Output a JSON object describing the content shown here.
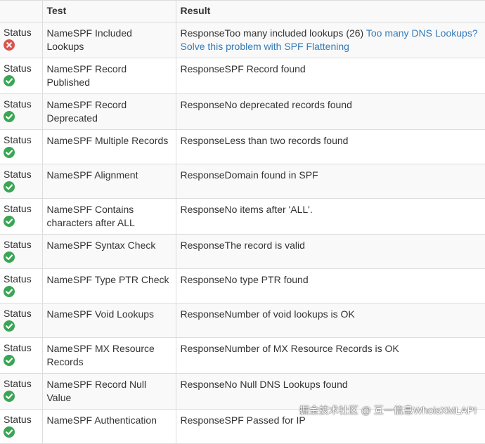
{
  "table": {
    "headers": {
      "status": "",
      "test": "Test",
      "result": "Result"
    },
    "rows": [
      {
        "status_label": "Status",
        "status": "fail",
        "name_prefix": "Name",
        "test": "SPF Included Lookups",
        "response_prefix": "Response",
        "result": "Too many included lookups (26) ",
        "link": "Too many DNS Lookups? Solve this problem with SPF Flattening"
      },
      {
        "status_label": "Status",
        "status": "ok",
        "name_prefix": "Name",
        "test": "SPF Record Published",
        "response_prefix": "Response",
        "result": "SPF Record found",
        "link": ""
      },
      {
        "status_label": "Status",
        "status": "ok",
        "name_prefix": "Name",
        "test": "SPF Record Deprecated",
        "response_prefix": "Response",
        "result": "No deprecated records found",
        "link": ""
      },
      {
        "status_label": "Status",
        "status": "ok",
        "name_prefix": "Name",
        "test": "SPF Multiple Records",
        "response_prefix": "Response",
        "result": "Less than two records found",
        "link": ""
      },
      {
        "status_label": "Status",
        "status": "ok",
        "name_prefix": "Name",
        "test": "SPF Alignment",
        "response_prefix": "Response",
        "result": "Domain found in SPF",
        "link": ""
      },
      {
        "status_label": "Status",
        "status": "ok",
        "name_prefix": "Name",
        "test": "SPF Contains characters after ALL",
        "response_prefix": "Response",
        "result": "No items after 'ALL'.",
        "link": ""
      },
      {
        "status_label": "Status",
        "status": "ok",
        "name_prefix": "Name",
        "test": "SPF Syntax Check",
        "response_prefix": "Response",
        "result": "The record is valid",
        "link": ""
      },
      {
        "status_label": "Status",
        "status": "ok",
        "name_prefix": "Name",
        "test": "SPF Type PTR Check",
        "response_prefix": "Response",
        "result": "No type PTR found",
        "link": ""
      },
      {
        "status_label": "Status",
        "status": "ok",
        "name_prefix": "Name",
        "test": "SPF Void Lookups",
        "response_prefix": "Response",
        "result": "Number of void lookups is OK",
        "link": ""
      },
      {
        "status_label": "Status",
        "status": "ok",
        "name_prefix": "Name",
        "test": "SPF MX Resource Records",
        "response_prefix": "Response",
        "result": "Number of MX Resource Records is OK",
        "link": ""
      },
      {
        "status_label": "Status",
        "status": "ok",
        "name_prefix": "Name",
        "test": "SPF Record Null Value",
        "response_prefix": "Response",
        "result": "No Null DNS Lookups found",
        "link": ""
      },
      {
        "status_label": "Status",
        "status": "ok",
        "name_prefix": "Name",
        "test": "SPF Authentication",
        "response_prefix": "Response",
        "result": "SPF Passed for IP",
        "link": ""
      }
    ]
  },
  "watermark": "掘金技术社区 @ 互一信息WhoisXMLAPI",
  "colors": {
    "ok": "#3aa655",
    "fail": "#d9534f",
    "link": "#337ab7"
  },
  "icons": {
    "ok": "check-circle-icon",
    "fail": "x-circle-icon"
  }
}
